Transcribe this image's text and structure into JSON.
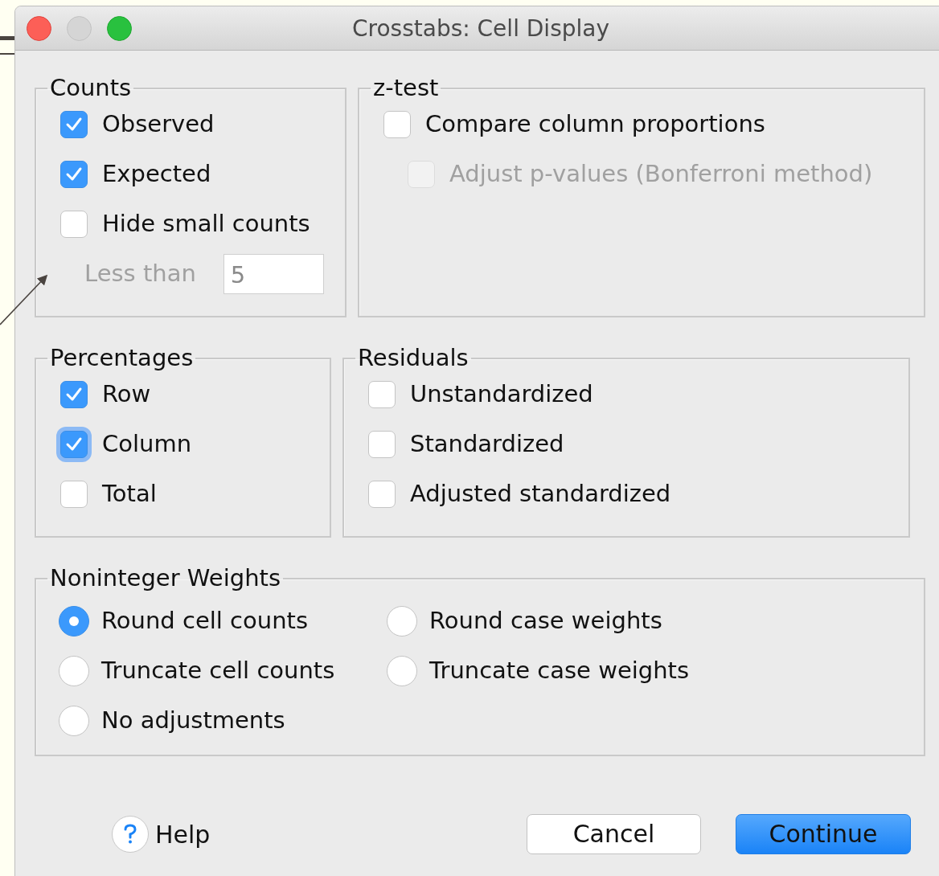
{
  "window": {
    "title": "Crosstabs: Cell Display"
  },
  "groups": [
    {
      "title": "Counts",
      "items": [
        {
          "kind": "checkbox",
          "label": "Observed",
          "checked": true,
          "disabled": false,
          "focused": false
        },
        {
          "kind": "checkbox",
          "label": "Expected",
          "checked": true,
          "disabled": false,
          "focused": false
        },
        {
          "kind": "checkbox",
          "label": "Hide small counts",
          "checked": false,
          "disabled": false,
          "focused": false,
          "children": [
            {
              "kind": "field",
              "label": "Less than",
              "value": "5",
              "disabled": true
            }
          ]
        }
      ]
    },
    {
      "title": "z-test",
      "items": [
        {
          "kind": "checkbox",
          "label": "Compare column proportions",
          "checked": false,
          "disabled": false,
          "focused": false,
          "children": [
            {
              "kind": "checkbox",
              "label": "Adjust p-values (Bonferroni method)",
              "checked": false,
              "disabled": true,
              "focused": false
            }
          ]
        }
      ]
    },
    {
      "title": "Percentages",
      "items": [
        {
          "kind": "checkbox",
          "label": "Row",
          "checked": true,
          "disabled": false,
          "focused": false
        },
        {
          "kind": "checkbox",
          "label": "Column",
          "checked": true,
          "disabled": false,
          "focused": true
        },
        {
          "kind": "checkbox",
          "label": "Total",
          "checked": false,
          "disabled": false,
          "focused": false
        }
      ]
    },
    {
      "title": "Residuals",
      "items": [
        {
          "kind": "checkbox",
          "label": "Unstandardized",
          "checked": false,
          "disabled": false,
          "focused": false
        },
        {
          "kind": "checkbox",
          "label": "Standardized",
          "checked": false,
          "disabled": false,
          "focused": false
        },
        {
          "kind": "checkbox",
          "label": "Adjusted standardized",
          "checked": false,
          "disabled": false,
          "focused": false
        }
      ]
    },
    {
      "title": "Noninteger Weights",
      "items": [
        {
          "kind": "radio",
          "label": "Round cell counts",
          "selected": true
        },
        {
          "kind": "radio",
          "label": "Round case weights",
          "selected": false
        },
        {
          "kind": "radio",
          "label": "Truncate cell counts",
          "selected": false
        },
        {
          "kind": "radio",
          "label": "Truncate case weights",
          "selected": false
        },
        {
          "kind": "radio",
          "label": "No adjustments",
          "selected": false
        }
      ]
    }
  ],
  "buttons": [
    {
      "kind": "help",
      "label": "Help"
    },
    {
      "kind": "default",
      "label": "Cancel"
    },
    {
      "kind": "primary",
      "label": "Continue"
    }
  ]
}
